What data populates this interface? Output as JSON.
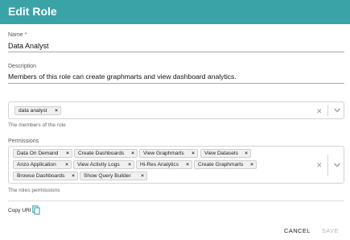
{
  "dialog": {
    "title": "Edit Role"
  },
  "name_field": {
    "label": "Name *",
    "value": "Data Analyst"
  },
  "description_field": {
    "label": "Description",
    "value": "Members of this role can create graphmarts and view dashboard analytics."
  },
  "members_field": {
    "chips": [
      "data analyst"
    ],
    "helper": "The members of the role"
  },
  "permissions_field": {
    "label": "Permissions",
    "chips": [
      "Data On Demand",
      "Create Dashboards",
      "View Graphmarts",
      "View Datasets",
      "Anzo Application",
      "View Activity Logs",
      "Hi-Res Analytics",
      "Create Graphmarts",
      "Browse Dashboards",
      "Show Query Builder"
    ],
    "helper": "The roles permissions"
  },
  "copy_uri_label": "Copy URI",
  "actions": {
    "cancel": "CANCEL",
    "save": "SAVE"
  },
  "colors": {
    "header": "#3aa3a8",
    "disabled_text": "#b7b7b7"
  },
  "icons": {
    "chip_remove": "close-icon",
    "clear": "clear-icon",
    "dropdown": "chevron-down-icon",
    "copy": "copy-icon"
  },
  "symbols": {
    "chip_remove": "×",
    "clear": "✕"
  }
}
